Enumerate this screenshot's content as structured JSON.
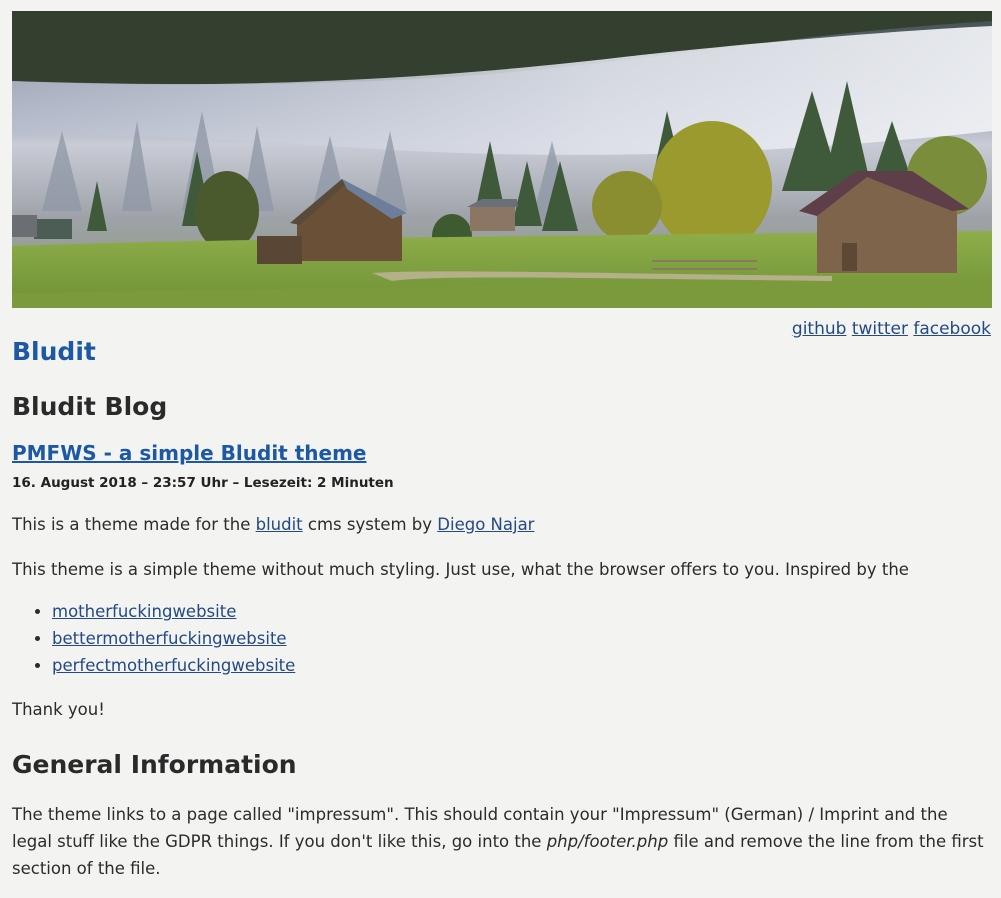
{
  "header": {
    "banner_alt": "landscape banner",
    "social_links": [
      {
        "label": "github"
      },
      {
        "label": "twitter"
      },
      {
        "label": "facebook"
      }
    ],
    "site_title": "Bludit"
  },
  "main": {
    "blog_title": "Bludit Blog",
    "post": {
      "title": "PMFWS - a simple Bludit theme",
      "meta": "16. August 2018 – 23:57 Uhr – Lesezeit: 2 Minuten",
      "p1_before": "This is a theme made for the ",
      "p1_link1": "bludit",
      "p1_middle": " cms system by ",
      "p1_link2": "Diego Najar",
      "p2": "This theme is a simple theme without much styling. Just use, what the browser offers to you. Inspired by the",
      "links": [
        "motherfuckingwebsite",
        "bettermotherfuckingwebsite",
        "perfectmotherfuckingwebsite"
      ],
      "thanks": "Thank you!"
    },
    "section": {
      "title": "General Information",
      "text_before": "The theme links to a page called \"impressum\". This should contain your \"Impressum\" (German) / Imprint and the legal stuff like the GDPR things. If you don't like this, go into the ",
      "text_em": "php/footer.php",
      "text_after": " file and remove the line from the first section of the file."
    }
  },
  "colors": {
    "link": "#234a84",
    "title_blue": "#1d58a3",
    "background": "#f3f3f1"
  }
}
